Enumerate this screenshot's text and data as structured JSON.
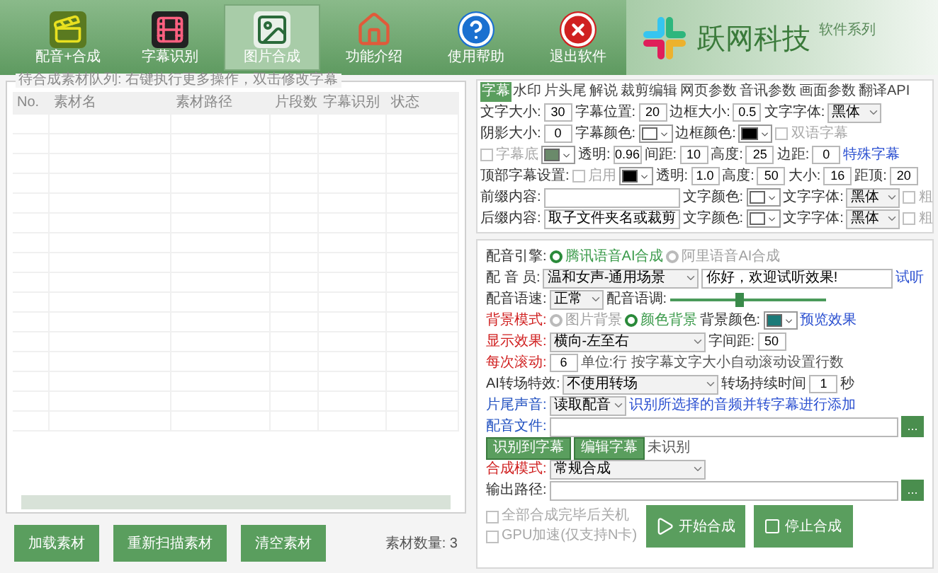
{
  "toolbar": [
    {
      "label": "配音+合成",
      "kind": "clapper",
      "selected": false
    },
    {
      "label": "字幕识别",
      "kind": "film",
      "selected": false
    },
    {
      "label": "图片合成",
      "kind": "picture",
      "selected": true
    },
    {
      "label": "功能介绍",
      "kind": "house",
      "selected": false
    },
    {
      "label": "使用帮助",
      "kind": "help",
      "selected": false
    },
    {
      "label": "退出软件",
      "kind": "exit",
      "selected": false
    }
  ],
  "logo": {
    "brand": "跃网科技",
    "tagline": "软件系列"
  },
  "queue": {
    "legend": "待合成素材队列: 右键执行更多操作，双击修改字幕",
    "columns": [
      "No.",
      "素材名",
      "素材路径",
      "片段数",
      "字幕识别",
      "状态"
    ]
  },
  "queue_buttons": [
    "加载素材",
    "重新扫描素材",
    "清空素材"
  ],
  "material_count": "素材数量: 3",
  "tabs": [
    {
      "label": "字幕",
      "selected": true
    },
    {
      "label": "水印",
      "selected": false
    },
    {
      "label": "片头尾",
      "selected": false
    },
    {
      "label": "解说",
      "selected": false
    },
    {
      "label": "裁剪编辑",
      "selected": false
    },
    {
      "label": "网页参数",
      "selected": false
    },
    {
      "label": "音讯参数",
      "selected": false
    },
    {
      "label": "画面参数",
      "selected": false
    },
    {
      "label": "翻译API",
      "selected": false
    }
  ],
  "subtitle_settings": [
    [
      {
        "kind": "label",
        "text": "文字大小:"
      },
      {
        "kind": "input",
        "value": "30"
      },
      {
        "kind": "label",
        "text": "字幕位置:"
      },
      {
        "kind": "input",
        "value": "20"
      },
      {
        "kind": "label",
        "text": "边框大小:"
      },
      {
        "kind": "input",
        "value": "0.5"
      },
      {
        "kind": "label",
        "text": "文字字体:"
      },
      {
        "kind": "select",
        "value": "黑体"
      }
    ],
    [
      {
        "kind": "label",
        "text": "阴影大小:"
      },
      {
        "kind": "input",
        "value": "0"
      },
      {
        "kind": "label",
        "text": "字幕颜色:"
      },
      {
        "kind": "color",
        "color": "#ffffff"
      },
      {
        "kind": "label",
        "text": "边框颜色:"
      },
      {
        "kind": "color",
        "color": "#000000"
      },
      {
        "kind": "checkbox",
        "label": "双语字幕",
        "checked": false,
        "disabled": true
      }
    ],
    [
      {
        "kind": "checkbox",
        "label": "字幕底",
        "checked": false,
        "disabled": true
      },
      {
        "kind": "color",
        "color": "#6a8a6a"
      },
      {
        "kind": "label",
        "text": "透明:"
      },
      {
        "kind": "input",
        "value": "0.96"
      },
      {
        "kind": "label",
        "text": "间距:"
      },
      {
        "kind": "input",
        "value": "10"
      },
      {
        "kind": "label",
        "text": "高度:"
      },
      {
        "kind": "input",
        "value": "25"
      },
      {
        "kind": "label",
        "text": "边距:"
      },
      {
        "kind": "input",
        "value": "0"
      },
      {
        "kind": "link",
        "text": "特殊字幕"
      }
    ],
    [
      {
        "kind": "label",
        "text": "顶部字幕设置:"
      },
      {
        "kind": "checkbox",
        "label": "启用",
        "checked": false,
        "disabled": true
      },
      {
        "kind": "color",
        "color": "#000000"
      },
      {
        "kind": "label",
        "text": "透明:"
      },
      {
        "kind": "input",
        "value": "1.0"
      },
      {
        "kind": "label",
        "text": "高度:"
      },
      {
        "kind": "input",
        "value": "50"
      },
      {
        "kind": "label",
        "text": "大小:"
      },
      {
        "kind": "input",
        "value": "16"
      },
      {
        "kind": "label",
        "text": "距顶:"
      },
      {
        "kind": "input",
        "value": "20"
      }
    ],
    [
      {
        "kind": "label",
        "text": "前缀内容:"
      },
      {
        "kind": "text_input"
      },
      {
        "kind": "label",
        "text": "文字颜色:"
      },
      {
        "kind": "color",
        "color": "#ffffff"
      },
      {
        "kind": "label",
        "text": "文字字体:"
      },
      {
        "kind": "select",
        "value": "黑体"
      },
      {
        "kind": "checkbox",
        "label": "粗",
        "checked": false,
        "disabled": true
      }
    ],
    [
      {
        "kind": "label",
        "text": "后缀内容:"
      },
      {
        "kind": "text_input",
        "value": "取子文件夹名或裁剪"
      },
      {
        "kind": "label",
        "text": "文字颜色:"
      },
      {
        "kind": "color",
        "color": "#ffffff"
      },
      {
        "kind": "label",
        "text": "文字字体:"
      },
      {
        "kind": "select",
        "value": "黑体"
      },
      {
        "kind": "checkbox",
        "label": "粗",
        "checked": false,
        "disabled": true
      }
    ]
  ],
  "voice_settings": [
    [
      {
        "kind": "label",
        "text": "配音引擎:"
      },
      {
        "kind": "radio",
        "label": "腾讯语音AI合成",
        "selected": true
      },
      {
        "kind": "radio",
        "label": "阿里语音AI合成",
        "selected": false
      }
    ],
    [
      {
        "kind": "label",
        "text": "配 音 员:"
      },
      {
        "kind": "wide_select",
        "value": "温和女声-通用场景"
      },
      {
        "kind": "text_input",
        "value": "你好，欢迎试听效果!"
      },
      {
        "kind": "link",
        "text": "试听"
      }
    ],
    [
      {
        "kind": "label",
        "text": "配音语速:"
      },
      {
        "kind": "select",
        "value": "正常"
      },
      {
        "kind": "label",
        "text": "配音语调:"
      },
      {
        "kind": "slider",
        "level": 0.45
      }
    ],
    [
      {
        "kind": "label",
        "text": "背景模式:",
        "color": "#d02020"
      },
      {
        "kind": "radio",
        "label": "图片背景",
        "selected": false
      },
      {
        "kind": "radio",
        "label": "颜色背景",
        "selected": true
      },
      {
        "kind": "label",
        "text": "背景颜色:"
      },
      {
        "kind": "color",
        "color": "#1a7a78"
      },
      {
        "kind": "link",
        "text": "预览效果"
      }
    ],
    [
      {
        "kind": "label",
        "text": "显示效果:",
        "color": "#d02020"
      },
      {
        "kind": "wide_select",
        "value": "横向-左至右"
      },
      {
        "kind": "label",
        "text": "字间距:"
      },
      {
        "kind": "input",
        "value": "50"
      }
    ],
    [
      {
        "kind": "label",
        "text": "每次滚动:",
        "color": "#d02020"
      },
      {
        "kind": "input",
        "value": "6"
      },
      {
        "kind": "note",
        "text": "单位:行 按字幕文字大小自动滚动设置行数"
      }
    ],
    [
      {
        "kind": "label",
        "text": "AI转场特效:"
      },
      {
        "kind": "wide_select",
        "value": "不使用转场"
      },
      {
        "kind": "label",
        "text": "转场持续时间"
      },
      {
        "kind": "input",
        "value": "1"
      },
      {
        "kind": "label",
        "text": "秒"
      }
    ],
    [
      {
        "kind": "label",
        "text": "片尾声音:",
        "color": "#2050c0"
      },
      {
        "kind": "select",
        "value": "读取配音"
      },
      {
        "kind": "link",
        "text": "识别所选择的音频并转字幕进行添加"
      }
    ],
    [
      {
        "kind": "label",
        "text": "配音文件:",
        "color": "#2050c0"
      },
      {
        "kind": "text_input"
      },
      {
        "kind": "browse",
        "text": "..."
      }
    ],
    [
      {
        "kind": "button",
        "text": "识别到字幕"
      },
      {
        "kind": "button",
        "text": "编辑字幕"
      },
      {
        "kind": "note",
        "text": "未识别"
      }
    ],
    [
      {
        "kind": "label",
        "text": "合成模式:",
        "color": "#d02020"
      },
      {
        "kind": "wide_select",
        "value": "常规合成"
      }
    ],
    [
      {
        "kind": "label",
        "text": "输出路径:"
      },
      {
        "kind": "text_input"
      },
      {
        "kind": "browse",
        "text": "..."
      }
    ]
  ],
  "finish_options": [
    {
      "label": "全部合成完毕后关机",
      "checked": false,
      "disabled": true
    },
    {
      "label": "GPU加速(仅支持N卡)",
      "checked": false,
      "disabled": true
    }
  ],
  "actions": [
    {
      "label": "开始合成",
      "kind": "play"
    },
    {
      "label": "停止合成",
      "kind": "stop"
    }
  ]
}
